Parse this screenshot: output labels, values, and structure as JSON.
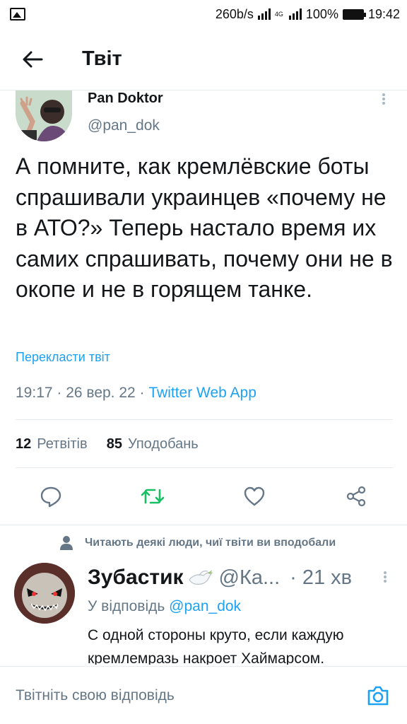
{
  "status_bar": {
    "speed": "260b/s",
    "network": "4G",
    "battery": "100%",
    "time": "19:42"
  },
  "header": {
    "title": "Твіт"
  },
  "tweet": {
    "author_name": "Pan Doktor",
    "author_handle": "@pan_dok",
    "text": "А помните, как кремлёвские боты спрашивали украинцев «почему не в АТО?» Теперь настало время их самих спрашивать, почему они не в окопе и не в горящем танке.",
    "translate_label": "Перекласти твіт",
    "timestamp": "19:17 · 26 вер. 22 · ",
    "source_app": "Twitter Web App",
    "retweets_count": "12",
    "retweets_label": "Ретвітів",
    "likes_count": "85",
    "likes_label": "Уподобань"
  },
  "social_context": "Читають деякі люди, чиї твіти ви вподобали",
  "reply": {
    "author_name": "Зубастик",
    "author_handle": "@Ка...",
    "separator": "·",
    "time": "21 хв",
    "reply_to_label": "У відповідь ",
    "reply_to_handle": "@pan_dok",
    "text": "С одной стороны круто, если каждую кремлемразь накроет Хаймарсом."
  },
  "compose": {
    "placeholder": "Твітніть свою відповідь"
  },
  "colors": {
    "accent": "#1da1f2",
    "retweet": "#17bf63",
    "secondary_text": "#657786",
    "primary_text": "#14171a"
  }
}
